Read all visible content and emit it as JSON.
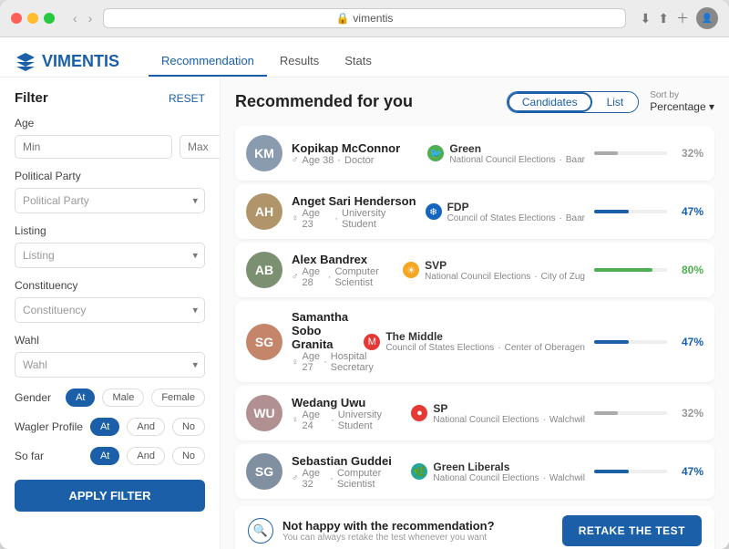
{
  "browser": {
    "url": "vimentis",
    "lock_icon": "🔒"
  },
  "app": {
    "logo": "VIMENTIS",
    "nav": {
      "tabs": [
        {
          "label": "Recommendation",
          "active": true
        },
        {
          "label": "Results",
          "active": false
        },
        {
          "label": "Stats",
          "active": false
        }
      ]
    }
  },
  "page": {
    "title": "Recommended for you",
    "view_toggle": {
      "candidates_label": "Candidates",
      "list_label": "List"
    },
    "sort": {
      "label": "Sort by",
      "value": "Percentage"
    }
  },
  "filter": {
    "title": "Filter",
    "reset_label": "RESET",
    "age": {
      "label": "Age",
      "min_placeholder": "Min",
      "max_placeholder": "Max"
    },
    "political_party": {
      "label": "Political Party",
      "placeholder": "Political Party"
    },
    "listing": {
      "label": "Listing",
      "placeholder": "Listing"
    },
    "constituency": {
      "label": "Constituency",
      "placeholder": "Constituency"
    },
    "wahl": {
      "label": "Wahl",
      "placeholder": "Wahl"
    },
    "gender": {
      "label": "Gender",
      "options": [
        "At",
        "Male",
        "Female"
      ]
    },
    "wagler_profile": {
      "label": "Wagler Profile",
      "options": [
        "At",
        "And",
        "No"
      ]
    },
    "so_far": {
      "label": "So far",
      "options": [
        "At",
        "And",
        "No"
      ]
    },
    "apply_label": "APPLY FILTER"
  },
  "candidates": [
    {
      "name": "Kopikap McConnor",
      "gender": "♂",
      "age": "Age 38",
      "occupation": "Doctor",
      "party": "Green",
      "party_color": "#4CAF50",
      "party_icon": "🐦",
      "election": "National Council Elections",
      "location": "Baar",
      "match": 32,
      "bar_color": "#aaa",
      "initials": "KM",
      "avatar_color": "#8a9bb0"
    },
    {
      "name": "Anget Sari Henderson",
      "gender": "♀",
      "age": "Age 23",
      "occupation": "University Student",
      "party": "FDP",
      "party_color": "#1565C0",
      "party_icon": "❄",
      "election": "Council of States Elections",
      "location": "Baar",
      "match": 47,
      "bar_color": "#1a5fa8",
      "initials": "AH",
      "avatar_color": "#b0956a"
    },
    {
      "name": "Alex Bandrex",
      "gender": "♂",
      "age": "Age 28",
      "occupation": "Computer Scientist",
      "party": "SVP",
      "party_color": "#f5a623",
      "party_icon": "☀",
      "election": "National Council Elections",
      "location": "City of Zug",
      "match": 80,
      "bar_color": "#4CAF50",
      "initials": "AB",
      "avatar_color": "#7a9070"
    },
    {
      "name": "Samantha Sobo Granita",
      "gender": "♀",
      "age": "Age 27",
      "occupation": "Hospital Secretary",
      "party": "The Middle",
      "party_color": "#e53935",
      "party_icon": "M",
      "election": "Council of States Elections",
      "location": "Center of Oberagen",
      "match": 47,
      "bar_color": "#1a5fa8",
      "initials": "SG",
      "avatar_color": "#c4856a"
    },
    {
      "name": "Wedang Uwu",
      "gender": "♀",
      "age": "Age 24",
      "occupation": "University Student",
      "party": "SP",
      "party_color": "#e53935",
      "party_icon": "🔴",
      "election": "National Council Elections",
      "location": "Walchwil",
      "match": 32,
      "bar_color": "#aaa",
      "initials": "WU",
      "avatar_color": "#b09090"
    },
    {
      "name": "Sebastian Guddei",
      "gender": "♂",
      "age": "Age 32",
      "occupation": "Computer Scientist",
      "party": "Green Liberals",
      "party_color": "#26A69A",
      "party_icon": "🌿",
      "election": "National Council Elections",
      "location": "Walchwil",
      "match": 47,
      "bar_color": "#1a5fa8",
      "initials": "SG",
      "avatar_color": "#8090a0"
    }
  ],
  "footer": {
    "title": "Not happy with the recommendation?",
    "subtitle": "You can always retake the test whenever you want",
    "retake_label": "RETAKE THE TEST"
  }
}
